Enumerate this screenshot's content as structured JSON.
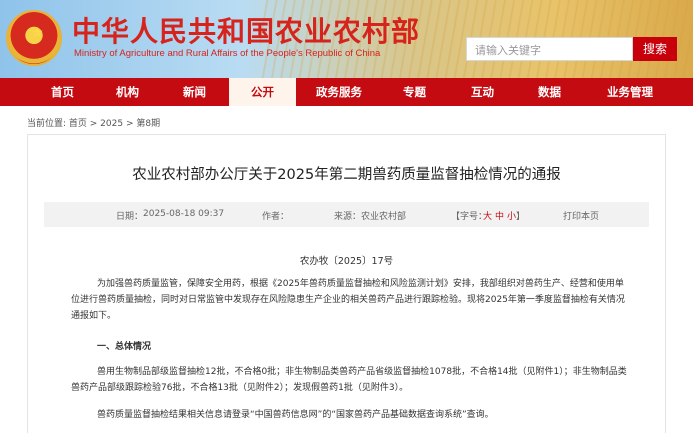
{
  "header": {
    "title": "中华人民共和国农业农村部",
    "subtitle": "Ministry of Agriculture and Rural Affairs of the People's Republic of China",
    "search_placeholder": "请输入关键字",
    "search_button": "搜索",
    "emblem_icon": "national-emblem-icon"
  },
  "nav": {
    "items": [
      "首页",
      "机构",
      "新闻",
      "公开",
      "政务服务",
      "专题",
      "互动",
      "数据",
      "业务管理"
    ],
    "active": "公开"
  },
  "breadcrumb": {
    "label": "当前位置:",
    "path": "首页 > 2025 > 第8期"
  },
  "article": {
    "title": "农业农村部办公厅关于2025年第二期兽药质量监督抽检情况的通报",
    "meta": {
      "date_label": "日期：",
      "date": "2025-08-18 09:37",
      "author_label": "作者：",
      "source_label": "来源：",
      "source": "农业农村部",
      "font_label": "【字号：",
      "font_large": "大",
      "font_medium": "中",
      "font_small": "小",
      "font_close": "】",
      "print": "打印本页"
    },
    "doc_no": "农办牧〔2025〕17号",
    "para1": "为加强兽药质量监管，保障安全用药，根据《2025年兽药质量监督抽检和风险监测计划》安排，我部组织对兽药生产、经营和使用单位进行兽药质量抽检，同时对日常监管中发现存在风险隐患生产企业的相关兽药产品进行跟踪检验。现将2025年第一季度监督抽检有关情况通报如下。",
    "section1": "一、总体情况",
    "para2": "兽用生物制品部级监督抽检12批，不合格0批；非生物制品类兽药产品省级监督抽检1078批，不合格14批（见附件1）；非生物制品类兽药产品部级跟踪检验76批，不合格13批（见附件2）；发现假兽药1批（见附件3）。",
    "para3": "兽药质量监督抽检结果相关信息请登录“中国兽药信息网”的“国家兽药产品基础数据查询系统”查询。"
  },
  "colors": {
    "brand_red": "#c40b12",
    "meta_bg": "#f2f2f2"
  }
}
